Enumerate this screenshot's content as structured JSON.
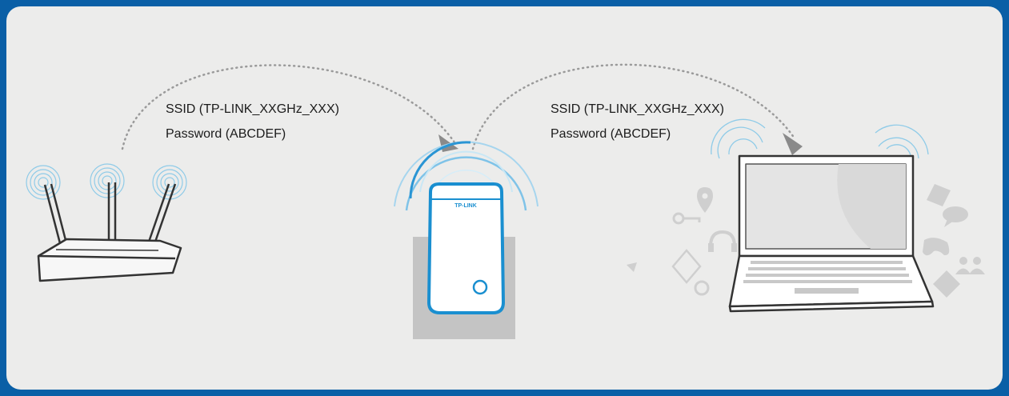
{
  "left_label": {
    "ssid": "SSID (TP-LINK_XXGHz_XXX)",
    "password": "Password (ABCDEF)"
  },
  "right_label": {
    "ssid": "SSID (TP-LINK_XXGHz_XXX)",
    "password": "Password (ABCDEF)"
  },
  "extender": {
    "brand": "TP-LINK"
  },
  "colors": {
    "frame": "#0a5fa6",
    "panel": "#ececeb",
    "accent_blue": "#1a8fd0",
    "wave_blue": "#7fc3e8",
    "device_gray": "#c4c4c4"
  }
}
